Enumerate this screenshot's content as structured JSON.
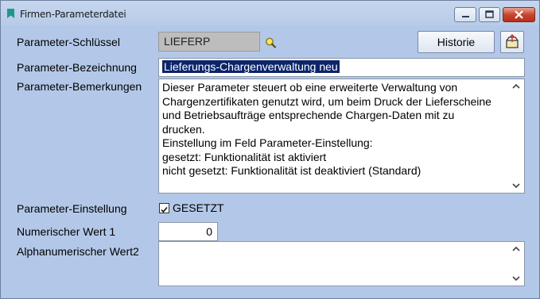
{
  "window": {
    "title": "Firmen-Parameterdatei"
  },
  "labels": {
    "key": "Parameter-Schlüssel",
    "name": "Parameter-Bezeichnung",
    "remarks": "Parameter-Bemerkungen",
    "setting": "Parameter-Einstellung",
    "numeric": "Numerischer Wert 1",
    "alpha": "Alphanumerischer Wert2"
  },
  "fields": {
    "key": "LIEFERP",
    "name": "Lieferungs-Chargenverwaltung neu",
    "remarks_lines": [
      "Dieser Parameter steuert ob eine erweiterte Verwaltung von",
      "Chargenzertifikaten genutzt wird, um beim Druck der Lieferscheine",
      "und Betriebsaufträge entsprechende Chargen-Daten mit zu",
      "drucken.",
      "",
      "Einstellung im Feld Parameter-Einstellung:",
      "gesetzt: Funktionalität ist aktiviert",
      "nicht gesetzt: Funktionalität ist deaktiviert (Standard)"
    ],
    "setting_checked": true,
    "setting_label": "GESETZT",
    "numeric": "0",
    "alpha": ""
  },
  "buttons": {
    "history": "Historie"
  },
  "icons": {
    "title": "bookmark-icon",
    "search": "magnifier-icon",
    "export": "export-icon",
    "minimize": "minimize-icon",
    "maximize": "maximize-icon",
    "close": "close-icon"
  },
  "colors": {
    "window_bg": "#b3c8e8",
    "selection": "#0b246a",
    "close_button": "#c9442e"
  }
}
